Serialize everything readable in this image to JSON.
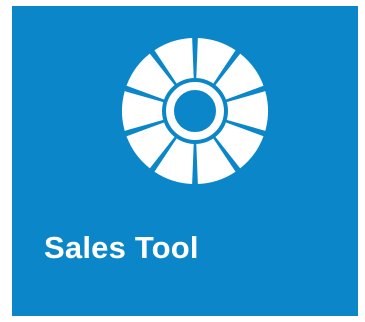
{
  "tile": {
    "title": "Sales Tool",
    "icon": "segmented-ring-icon",
    "background_color": "#0b87c9",
    "foreground_color": "#ffffff"
  }
}
